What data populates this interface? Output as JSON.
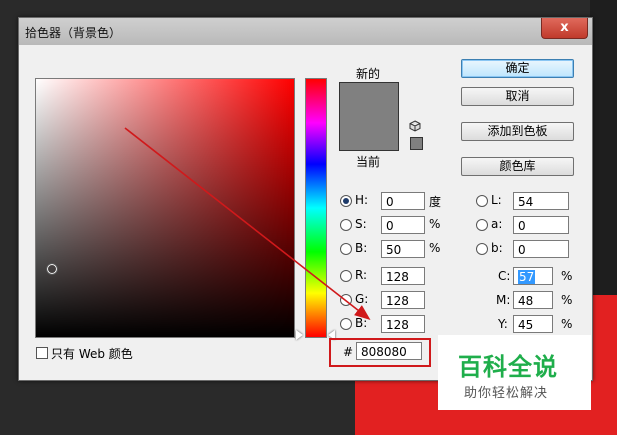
{
  "dialog": {
    "title": "拾色器（背景色）",
    "close_label": "x"
  },
  "preview": {
    "new_label": "新的",
    "current_label": "当前",
    "color": "#808080"
  },
  "buttons": {
    "ok": "确定",
    "cancel": "取消",
    "add_to_swatches": "添加到色板",
    "color_libraries": "颜色库"
  },
  "hsb": {
    "h": {
      "label": "H:",
      "value": "0",
      "unit": "度"
    },
    "s": {
      "label": "S:",
      "value": "0",
      "unit": "%"
    },
    "b": {
      "label": "B:",
      "value": "50",
      "unit": "%"
    }
  },
  "rgb": {
    "r": {
      "label": "R:",
      "value": "128"
    },
    "g": {
      "label": "G:",
      "value": "128"
    },
    "b": {
      "label": "B:",
      "value": "128"
    }
  },
  "lab": {
    "l": {
      "label": "L:",
      "value": "54"
    },
    "a": {
      "label": "a:",
      "value": "0"
    },
    "b": {
      "label": "b:",
      "value": "0"
    }
  },
  "cmyk": {
    "c": {
      "label": "C:",
      "value": "57",
      "unit": "%"
    },
    "m": {
      "label": "M:",
      "value": "48",
      "unit": "%"
    },
    "y": {
      "label": "Y:",
      "value": "45",
      "unit": "%"
    }
  },
  "hex": {
    "symbol": "#",
    "value": "808080"
  },
  "web_only": {
    "label": "只有 Web 颜色",
    "checked": false
  },
  "watermark": {
    "title": "百科全说",
    "subtitle": "助你轻松解决"
  },
  "colors": {
    "accent_arrow": "#d0191b",
    "watermark_green": "#1fae4b",
    "background_red": "#e22121"
  }
}
